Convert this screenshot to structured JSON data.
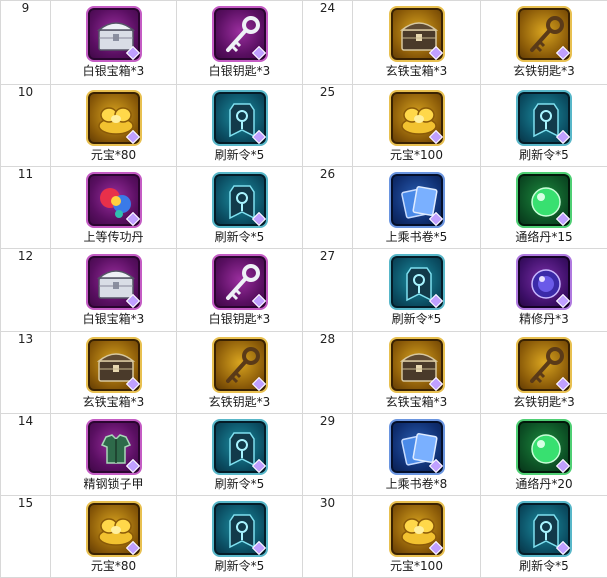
{
  "rows": [
    {
      "left_num": "9",
      "left": [
        {
          "label": "白银宝箱*3",
          "icon": "silver-chest-icon",
          "frame": "purple"
        },
        {
          "label": "白银钥匙*3",
          "icon": "silver-key-icon",
          "frame": "purple"
        }
      ],
      "right_num": "24",
      "right": [
        {
          "label": "玄铁宝箱*3",
          "icon": "iron-chest-icon",
          "frame": "gold"
        },
        {
          "label": "玄铁钥匙*3",
          "icon": "iron-key-icon",
          "frame": "gold"
        }
      ]
    },
    {
      "left_num": "10",
      "left": [
        {
          "label": "元宝*80",
          "icon": "gold-ingot-icon",
          "frame": "gold"
        },
        {
          "label": "刷新令*5",
          "icon": "refresh-token-icon",
          "frame": "teal"
        }
      ],
      "right_num": "25",
      "right": [
        {
          "label": "元宝*100",
          "icon": "gold-ingot-icon",
          "frame": "gold"
        },
        {
          "label": "刷新令*5",
          "icon": "refresh-token-icon",
          "frame": "teal"
        }
      ]
    },
    {
      "left_num": "11",
      "left": [
        {
          "label": "上等传功丹",
          "icon": "orb-pill-icon",
          "frame": "purple"
        },
        {
          "label": "刷新令*5",
          "icon": "refresh-token-icon",
          "frame": "teal"
        }
      ],
      "right_num": "26",
      "right": [
        {
          "label": "上乘书卷*5",
          "icon": "scroll-book-icon",
          "frame": "blue"
        },
        {
          "label": "通络丹*15",
          "icon": "green-pill-icon",
          "frame": "green"
        }
      ]
    },
    {
      "left_num": "12",
      "left": [
        {
          "label": "白银宝箱*3",
          "icon": "silver-chest-icon",
          "frame": "purple"
        },
        {
          "label": "白银钥匙*3",
          "icon": "silver-key-icon",
          "frame": "purple"
        }
      ],
      "right_num": "27",
      "right": [
        {
          "label": "刷新令*5",
          "icon": "refresh-token-icon",
          "frame": "teal"
        },
        {
          "label": "精修丹*3",
          "icon": "violet-pill-icon",
          "frame": "violet"
        }
      ]
    },
    {
      "left_num": "13",
      "left": [
        {
          "label": "玄铁宝箱*3",
          "icon": "iron-chest-icon",
          "frame": "gold"
        },
        {
          "label": "玄铁钥匙*3",
          "icon": "iron-key-icon",
          "frame": "gold"
        }
      ],
      "right_num": "28",
      "right": [
        {
          "label": "玄铁宝箱*3",
          "icon": "iron-chest-icon",
          "frame": "gold"
        },
        {
          "label": "玄铁钥匙*3",
          "icon": "iron-key-icon",
          "frame": "gold"
        }
      ]
    },
    {
      "left_num": "14",
      "left": [
        {
          "label": "精钢锁子甲",
          "icon": "chain-armor-icon",
          "frame": "purple"
        },
        {
          "label": "刷新令*5",
          "icon": "refresh-token-icon",
          "frame": "teal"
        }
      ],
      "right_num": "29",
      "right": [
        {
          "label": "上乘书卷*8",
          "icon": "scroll-book-icon",
          "frame": "blue"
        },
        {
          "label": "通络丹*20",
          "icon": "green-pill-icon",
          "frame": "green"
        }
      ]
    },
    {
      "left_num": "15",
      "left": [
        {
          "label": "元宝*80",
          "icon": "gold-ingot-icon",
          "frame": "gold"
        },
        {
          "label": "刷新令*5",
          "icon": "refresh-token-icon",
          "frame": "teal"
        }
      ],
      "right_num": "30",
      "right": [
        {
          "label": "元宝*100",
          "icon": "gold-ingot-icon",
          "frame": "gold"
        },
        {
          "label": "刷新令*5",
          "icon": "refresh-token-icon",
          "frame": "teal"
        }
      ]
    }
  ]
}
